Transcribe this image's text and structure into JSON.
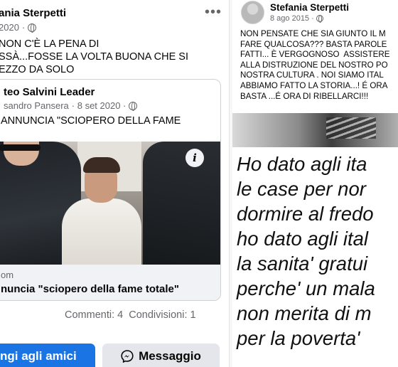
{
  "left_post": {
    "author": "ania Sterpetti",
    "date": "2020",
    "more_label": "•••",
    "text_lines": [
      "NON C'È LA PENA DI",
      "SSÀ...FOSSE LA VOLTA BUONA CHE SI",
      "EZZO DA SOLO"
    ],
    "shared": {
      "page_name": "teo Salvini Leader",
      "author": "sandro Pansera",
      "date": "· 8 set 2020 ·",
      "text": "ANNUNCIA \"SCIOPERO DELLA FAME",
      "info_label": "i",
      "link_domain": "om",
      "link_headline": "nuncia \"sciopero della fame totale\""
    },
    "stats": {
      "comments": "Commenti: 4",
      "shares": "Condivisioni: 1"
    },
    "buttons": {
      "primary": "ngi agli amici",
      "secondary": "Messaggio"
    }
  },
  "right_post": {
    "author": "Stefania Sterpetti",
    "date": "8 ago 2015 ·",
    "text_lines": [
      "NON PENSATE CHE SIA GIUNTO IL M",
      "FARE QUALCOSA??? BASTA PAROLE",
      "FATTI... È VERGOGNOSO  ASSISTERE",
      "ALLA DISTRUZIONE DEL NOSTRO PO",
      "NOSTRA CULTURA . NOI SIAMO ITAL",
      "ABBIAMO FATTO LA STORIA...! É ORA",
      "BASTA ...É ORA DI RIBELLARCI!!!"
    ],
    "image_text_lines": [
      "Ho dato agli ita",
      "le case per nor",
      "dormire al fredo",
      "ho dato agli ital",
      "la sanita' gratui",
      "perche' un mala",
      "non merita di m",
      "per la poverta' "
    ]
  },
  "icons": {
    "globe": "globe-icon",
    "messenger": "messenger-icon",
    "info": "info-icon"
  },
  "colors": {
    "primary_button": "#1b74e4",
    "secondary_button": "#e4e6eb",
    "meta_text": "#65676b",
    "link_footer": "#f0f2f5"
  }
}
